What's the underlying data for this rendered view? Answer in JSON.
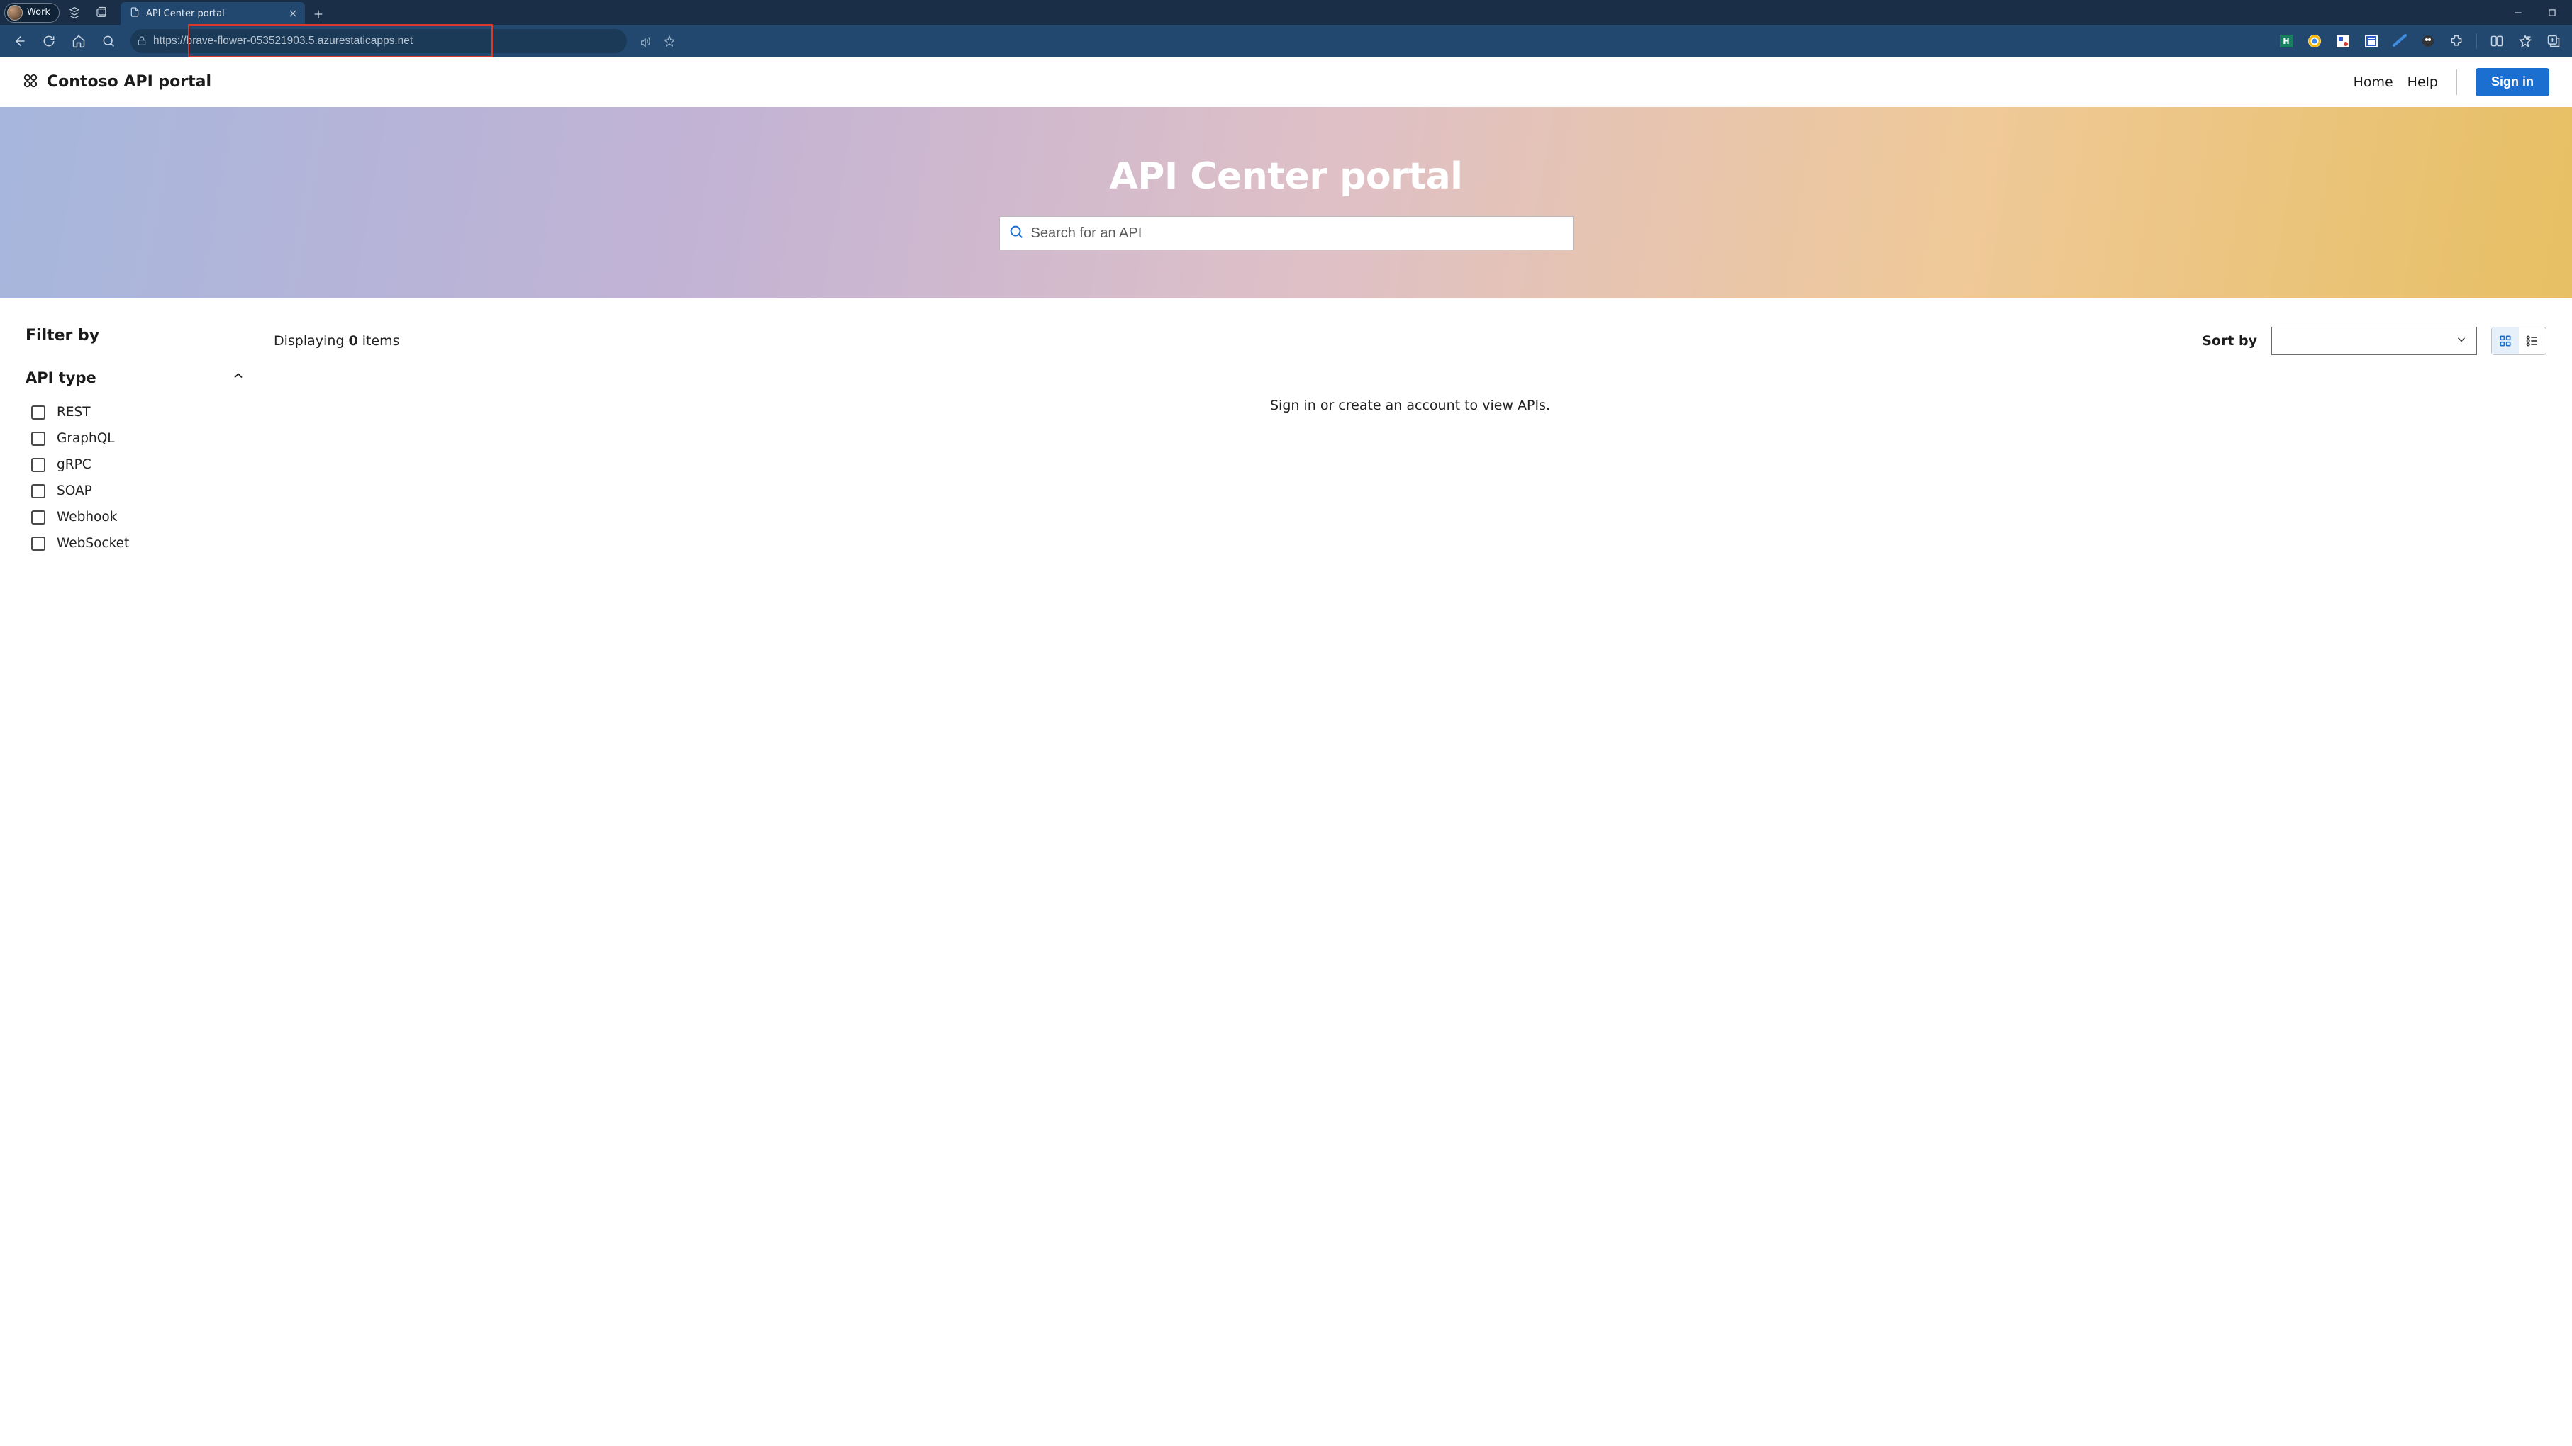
{
  "browser": {
    "profile_label": "Work",
    "tab_title": "API Center portal",
    "url": "https://brave-flower-053521903.5.azurestaticapps.net"
  },
  "header": {
    "brand": "Contoso API portal",
    "home": "Home",
    "help": "Help",
    "signin": "Sign in"
  },
  "hero": {
    "title": "API Center portal",
    "search_placeholder": "Search for an API"
  },
  "sidebar": {
    "filter_heading": "Filter by",
    "group_title": "API type",
    "options": [
      "REST",
      "GraphQL",
      "gRPC",
      "SOAP",
      "Webhook",
      "WebSocket"
    ]
  },
  "main": {
    "display_prefix": "Displaying ",
    "display_count": "0",
    "display_suffix": " items",
    "sort_label": "Sort by",
    "empty": "Sign in or create an account to view APIs."
  }
}
